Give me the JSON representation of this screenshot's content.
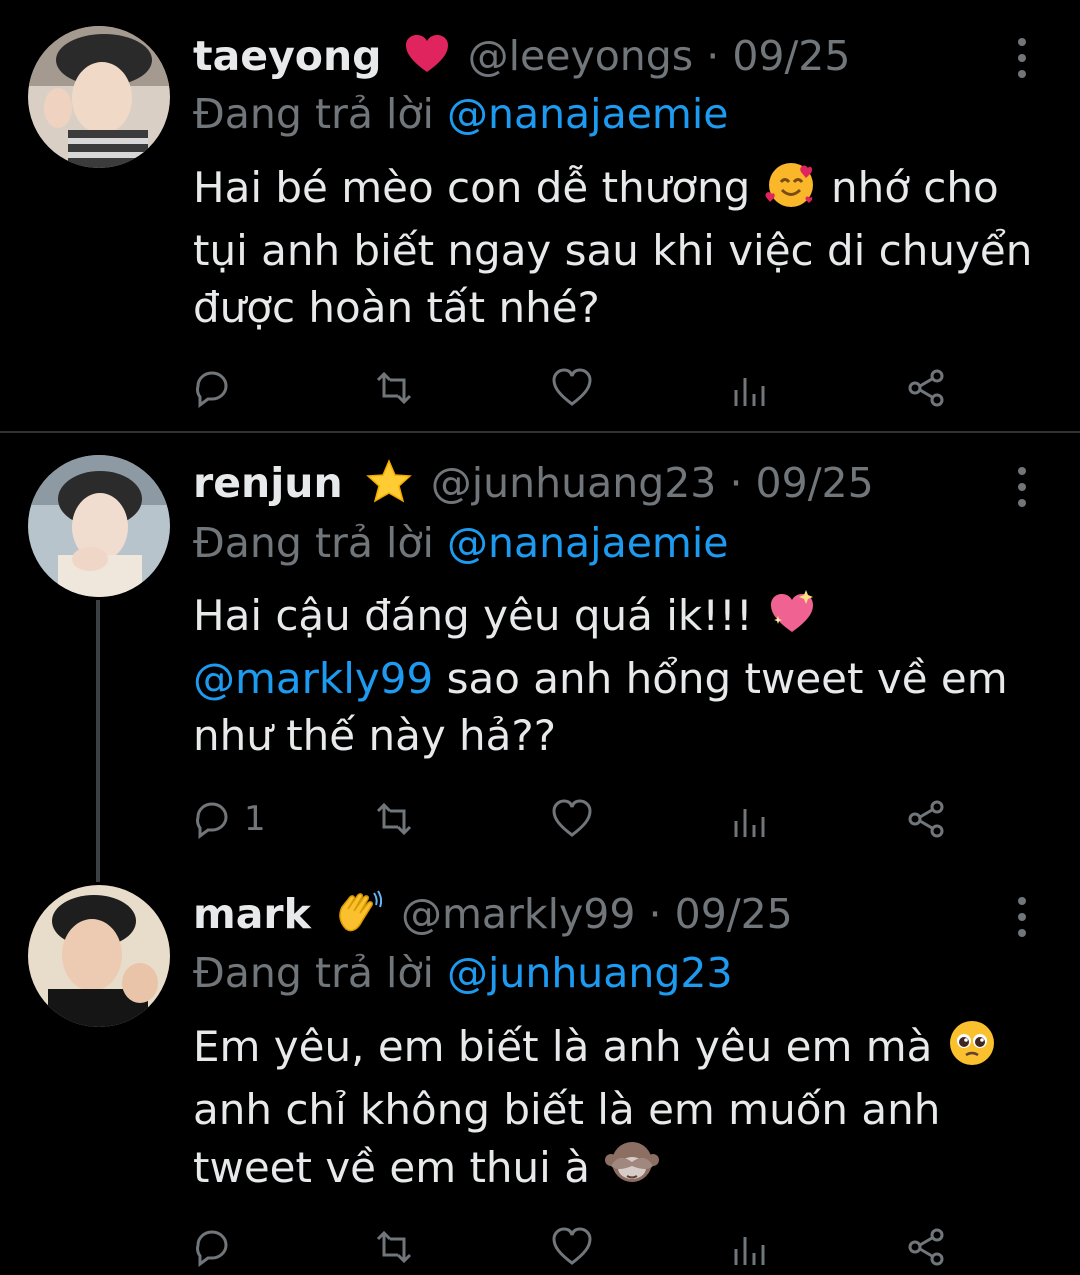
{
  "colors": {
    "background": "#000000",
    "text": "#e7e9ea",
    "secondary": "#71767b",
    "link": "#1d9bf0",
    "divider": "#2f3336"
  },
  "tweets": [
    {
      "name": "taeyong",
      "badge_icon": "red-heart-emoji",
      "handle": "@leeyongs",
      "separator": "·",
      "date": "09/25",
      "reply_prefix": "Đang trả lời",
      "reply_to": "@nanajaemie",
      "lines": [
        {
          "text": "Hai bé mèo con dễ thương",
          "emoji": "smiling-face-with-hearts-emoji",
          "text_after": "nhớ cho"
        },
        {
          "text": "tụi anh biết ngay sau khi việc di chuyển"
        },
        {
          "text": "được hoàn tất nhé?"
        }
      ],
      "actions": {
        "reply_count": "",
        "retweet_count": "",
        "like_count": ""
      }
    },
    {
      "name": "renjun",
      "badge_icon": "star-emoji",
      "handle": "@junhuang23",
      "separator": "·",
      "date": "09/25",
      "reply_prefix": "Đang trả lời",
      "reply_to": "@nanajaemie",
      "lines": [
        {
          "text": "Hai cậu đáng yêu quá ik!!!",
          "emoji": "sparkling-heart-emoji"
        },
        {
          "mention": "@markly99",
          "text": "sao anh hổng tweet về em"
        },
        {
          "text": "như thế này hả??"
        }
      ],
      "actions": {
        "reply_count": "1",
        "retweet_count": "",
        "like_count": ""
      }
    },
    {
      "name": "mark",
      "badge_icon": "waving-hand-emoji",
      "handle": "@markly99",
      "separator": "·",
      "date": "09/25",
      "reply_prefix": "Đang trả lời",
      "reply_to": "@junhuang23",
      "lines": [
        {
          "text": "Em yêu, em biết là anh yêu em mà",
          "emoji": "pleading-face-emoji"
        },
        {
          "text": "anh chỉ không biết là em muốn anh"
        },
        {
          "text": "tweet về em thui à",
          "emoji": "see-no-evil-monkey-emoji"
        }
      ],
      "actions": {
        "reply_count": "",
        "retweet_count": "",
        "like_count": ""
      }
    }
  ]
}
